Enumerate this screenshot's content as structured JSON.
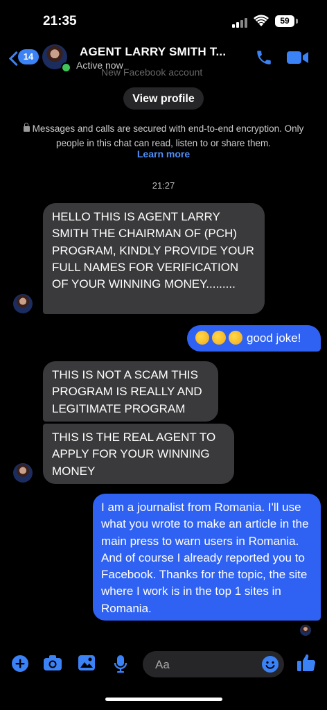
{
  "status_bar": {
    "time": "21:35",
    "battery": "59"
  },
  "header": {
    "back_count": "14",
    "contact_name": "AGENT LARRY SMITH T...",
    "status": "Active now"
  },
  "thread": {
    "faded_top_text": "New Facebook account",
    "view_profile": "View profile",
    "encryption_text": "Messages and calls are secured with end-to-end encryption. Only people in this chat can read, listen to or share them.",
    "learn_more": "Learn more",
    "timestamp": "21:27",
    "messages": [
      {
        "from": "contact",
        "text": "HELLO THIS IS  AGENT LARRY SMITH THE CHAIRMAN OF (PCH) PROGRAM,  KINDLY PROVIDE YOUR FULL NAMES FOR VERIFICATION OF YOUR WINNING MONEY........."
      },
      {
        "from": "me",
        "emojis": [
          "rolling-on-floor-laughing",
          "rolling-on-floor-laughing",
          "rolling-on-floor-laughing"
        ],
        "text": "good joke!"
      },
      {
        "from": "contact",
        "text": "THIS IS NOT A SCAM THIS PROGRAM IS REALLY AND LEGITIMATE PROGRAM"
      },
      {
        "from": "contact",
        "text": "THIS IS THE REAL AGENT TO APPLY FOR YOUR WINNING MONEY"
      },
      {
        "from": "me",
        "text": "I am a journalist from Romania. I'll use what you wrote to make an article in the main press to warn users in Romania. And of course I already reported you to Facebook. Thanks for the topic, the site where I work is in the top 1 sites in Romania."
      }
    ]
  },
  "composer": {
    "placeholder": "Aa"
  },
  "colors": {
    "accent": "#3b82f6",
    "outgoing_bubble": "#2f62f3",
    "incoming_bubble": "#3a3a3c"
  }
}
